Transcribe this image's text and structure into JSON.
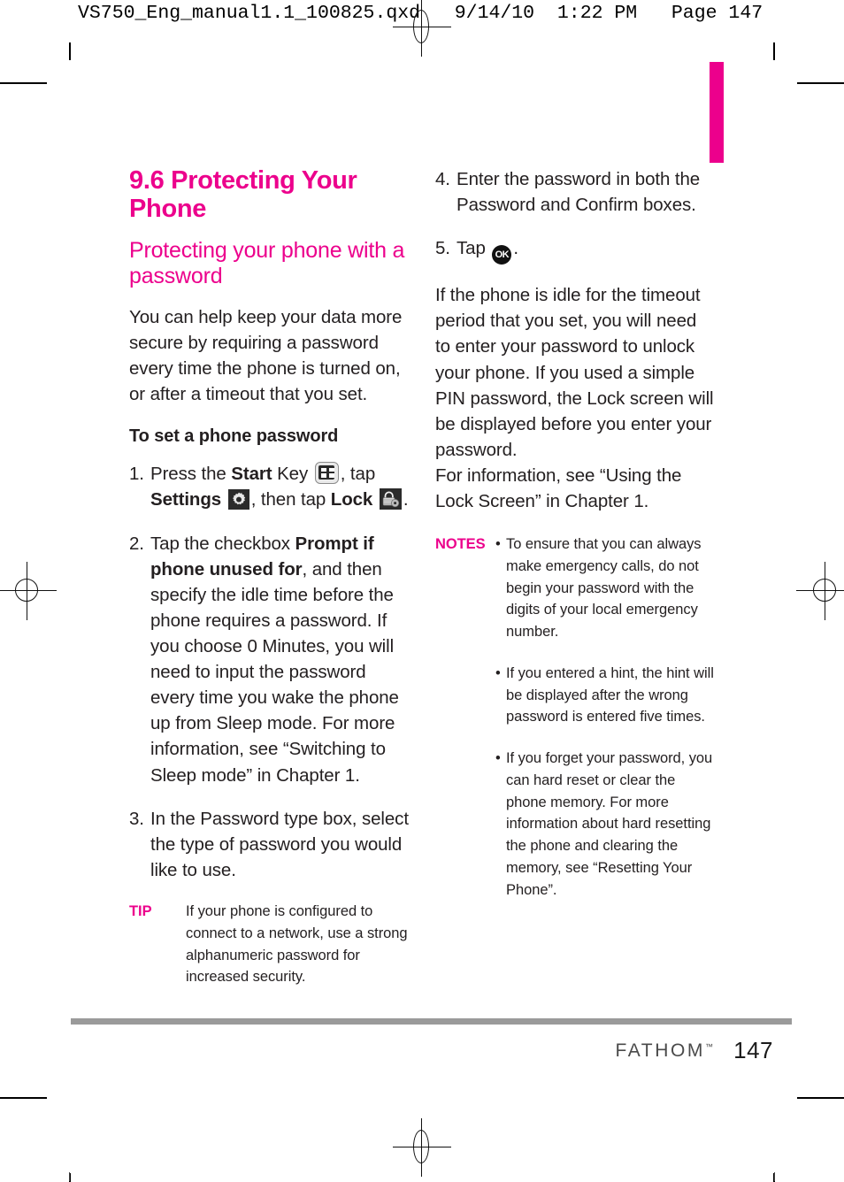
{
  "printer_slug": "VS750_Eng_manual1.1_100825.qxd   9/14/10  1:22 PM   Page 147",
  "colors": {
    "accent_magenta": "#ec008c",
    "body_text": "#231f20",
    "footer_rule": "#9a9a9a"
  },
  "left_column": {
    "section_title": "9.6 Protecting Your Phone",
    "sub_title": "Protecting your phone with a password",
    "intro_paragraph": "You can help keep your data more secure by requiring a password every time the phone is turned on, or after a timeout that you set.",
    "procedure_heading": "To set a phone password",
    "steps": [
      {
        "number": "1.",
        "parts": [
          {
            "type": "text",
            "value": "Press the "
          },
          {
            "type": "bold",
            "value": "Start"
          },
          {
            "type": "text",
            "value": " Key "
          },
          {
            "type": "icon",
            "value": "start-key-icon"
          },
          {
            "type": "text",
            "value": ", tap "
          },
          {
            "type": "bold",
            "value": "Settings"
          },
          {
            "type": "text",
            "value": " "
          },
          {
            "type": "icon",
            "value": "gear-icon"
          },
          {
            "type": "text",
            "value": ", then tap "
          },
          {
            "type": "bold",
            "value": "Lock"
          },
          {
            "type": "text",
            "value": " "
          },
          {
            "type": "icon",
            "value": "lock-icon"
          },
          {
            "type": "text",
            "value": "."
          }
        ]
      },
      {
        "number": "2.",
        "parts": [
          {
            "type": "text",
            "value": "Tap the checkbox "
          },
          {
            "type": "bold",
            "value": "Prompt if phone unused for"
          },
          {
            "type": "text",
            "value": ", and then specify the idle time before the phone requires a password. If you choose 0 Minutes, you will need to input the password every time you wake the phone up from Sleep mode. For more information, see “Switching to Sleep mode” in Chapter 1."
          }
        ]
      },
      {
        "number": "3.",
        "parts": [
          {
            "type": "text",
            "value": "In the Password type box, select the type of password you would like to use."
          }
        ]
      }
    ],
    "tip": {
      "label": "TIP",
      "text": "If your phone is configured to connect to a network, use a strong alphanumeric password for increased security."
    }
  },
  "right_column": {
    "steps": [
      {
        "number": "4.",
        "parts": [
          {
            "type": "text",
            "value": "Enter the password in both the Password and Confirm boxes."
          }
        ]
      },
      {
        "number": "5.",
        "parts": [
          {
            "type": "text",
            "value": "Tap "
          },
          {
            "type": "icon",
            "value": "ok-button-icon"
          },
          {
            "type": "text",
            "value": "."
          }
        ]
      }
    ],
    "paragraph_1": "If the phone is idle for the timeout period that you set, you will need to enter your password to unlock your phone. If you used a simple PIN password, the Lock screen will be displayed before you enter your password.",
    "paragraph_2": "For information, see “Using the Lock Screen” in Chapter 1.",
    "notes": {
      "label": "NOTES",
      "bullets": [
        "To ensure that you can always make emergency calls, do not begin your password with the digits of your local emergency number.",
        "If you entered a hint, the hint will be displayed after the wrong password is entered five times.",
        "If you forget your password, you can hard reset or clear the phone memory. For more information about hard resetting the phone and clearing the memory, see “Resetting Your Phone”."
      ],
      "bullet_glyph": "•"
    }
  },
  "footer": {
    "brand": "FATHOM",
    "trademark": "™",
    "page_number": "147"
  },
  "icons": {
    "ok_label": "OK"
  }
}
